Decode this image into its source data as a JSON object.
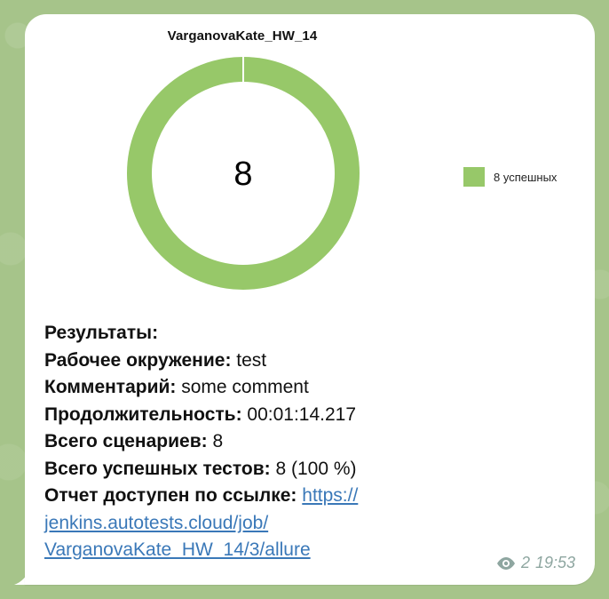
{
  "chart_data": {
    "type": "pie",
    "title": "VarganovaKate_HW_14",
    "center_label": "8",
    "series": [
      {
        "name": "8 успешных",
        "values": [
          8
        ],
        "color": "#97c869"
      }
    ],
    "legend": {
      "position": "right",
      "entries": [
        "8 успешных"
      ]
    },
    "donut": true
  },
  "message": {
    "results_label": "Результаты:",
    "environment_label": "Рабочее окружение:",
    "environment_value": "test",
    "comment_label": "Комментарий:",
    "comment_value": "some comment",
    "duration_label": "Продолжительность:",
    "duration_value": "00:01:14.217",
    "scenarios_label": "Всего сценариев:",
    "scenarios_value": "8",
    "passed_label": "Всего успешных тестов:",
    "passed_value": "8 (100 %)",
    "report_label": "Отчет доступен по ссылке:",
    "report_link_line1": "https://",
    "report_link_line2": "jenkins.autotests.cloud/job/",
    "report_link_line3": "VarganovaKate_HW_14/3/allure"
  },
  "meta": {
    "views": "2",
    "time": "19:53",
    "views_icon": "eye-icon"
  },
  "colors": {
    "chat_background": "#a6c48a",
    "bubble": "#ffffff",
    "success_green": "#97c869",
    "link": "#3a78b8",
    "meta": "#8ea6a0"
  }
}
